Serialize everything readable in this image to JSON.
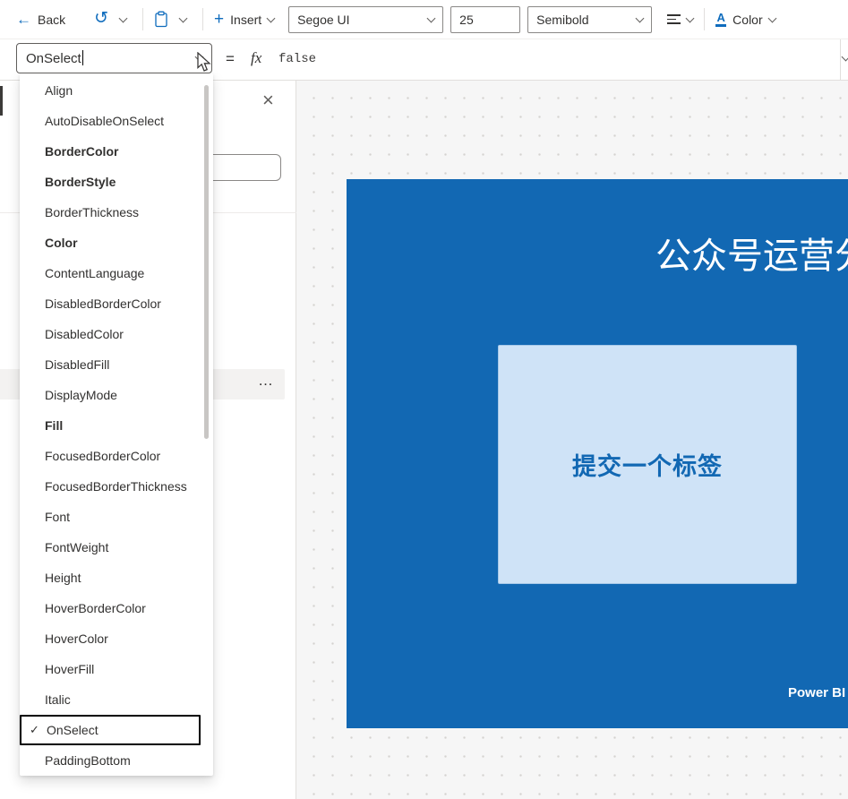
{
  "colors": {
    "accent": "#0f6cbd",
    "text": "#323130",
    "text-secondary": "#605e5c",
    "input-border": "#8a8886",
    "divider": "#e1dfdd",
    "panel-row": "#f3f2f1",
    "canvas-bg": "#f6f6f6",
    "canvas-dot": "#d4d2d0",
    "tile-bg": "#1268b3",
    "tile-button-bg": "#cfe3f7",
    "tile-button-border": "#a6c8e8",
    "tile-button-text": "#1268b3",
    "scrollbar": "#c8c6c4",
    "focus-border": "#000000"
  },
  "toolbar": {
    "back_label": "Back",
    "insert_label": "Insert",
    "font_name_value": "Segoe UI",
    "font_size_value": "25",
    "font_weight_value": "Semibold",
    "color_label": "Color"
  },
  "formula_bar": {
    "property_value": "OnSelect",
    "equals_sign": "=",
    "fx_label": "fx",
    "formula_value": "false"
  },
  "property_list": {
    "items": [
      {
        "label": "Align",
        "bold": false,
        "selected": false
      },
      {
        "label": "AutoDisableOnSelect",
        "bold": false,
        "selected": false
      },
      {
        "label": "BorderColor",
        "bold": true,
        "selected": false
      },
      {
        "label": "BorderStyle",
        "bold": true,
        "selected": false
      },
      {
        "label": "BorderThickness",
        "bold": false,
        "selected": false
      },
      {
        "label": "Color",
        "bold": true,
        "selected": false
      },
      {
        "label": "ContentLanguage",
        "bold": false,
        "selected": false
      },
      {
        "label": "DisabledBorderColor",
        "bold": false,
        "selected": false
      },
      {
        "label": "DisabledColor",
        "bold": false,
        "selected": false
      },
      {
        "label": "DisabledFill",
        "bold": false,
        "selected": false
      },
      {
        "label": "DisplayMode",
        "bold": false,
        "selected": false
      },
      {
        "label": "Fill",
        "bold": true,
        "selected": false
      },
      {
        "label": "FocusedBorderColor",
        "bold": false,
        "selected": false
      },
      {
        "label": "FocusedBorderThickness",
        "bold": false,
        "selected": false
      },
      {
        "label": "Font",
        "bold": false,
        "selected": false
      },
      {
        "label": "FontWeight",
        "bold": false,
        "selected": false
      },
      {
        "label": "Height",
        "bold": false,
        "selected": false
      },
      {
        "label": "HoverBorderColor",
        "bold": false,
        "selected": false
      },
      {
        "label": "HoverColor",
        "bold": false,
        "selected": false
      },
      {
        "label": "HoverFill",
        "bold": false,
        "selected": false
      },
      {
        "label": "Italic",
        "bold": false,
        "selected": false
      },
      {
        "label": "OnSelect",
        "bold": false,
        "selected": true
      },
      {
        "label": "PaddingBottom",
        "bold": false,
        "selected": false
      }
    ]
  },
  "side_panel": {
    "ellipsis": "…"
  },
  "canvas": {
    "tile": {
      "title": "公众号运营分析",
      "button_label": "提交一个标签",
      "brand": "Power BI"
    }
  },
  "icons": {
    "back_arrow": "←",
    "undo": "↺",
    "plus": "+",
    "close": "×",
    "checkmark": "✓"
  }
}
